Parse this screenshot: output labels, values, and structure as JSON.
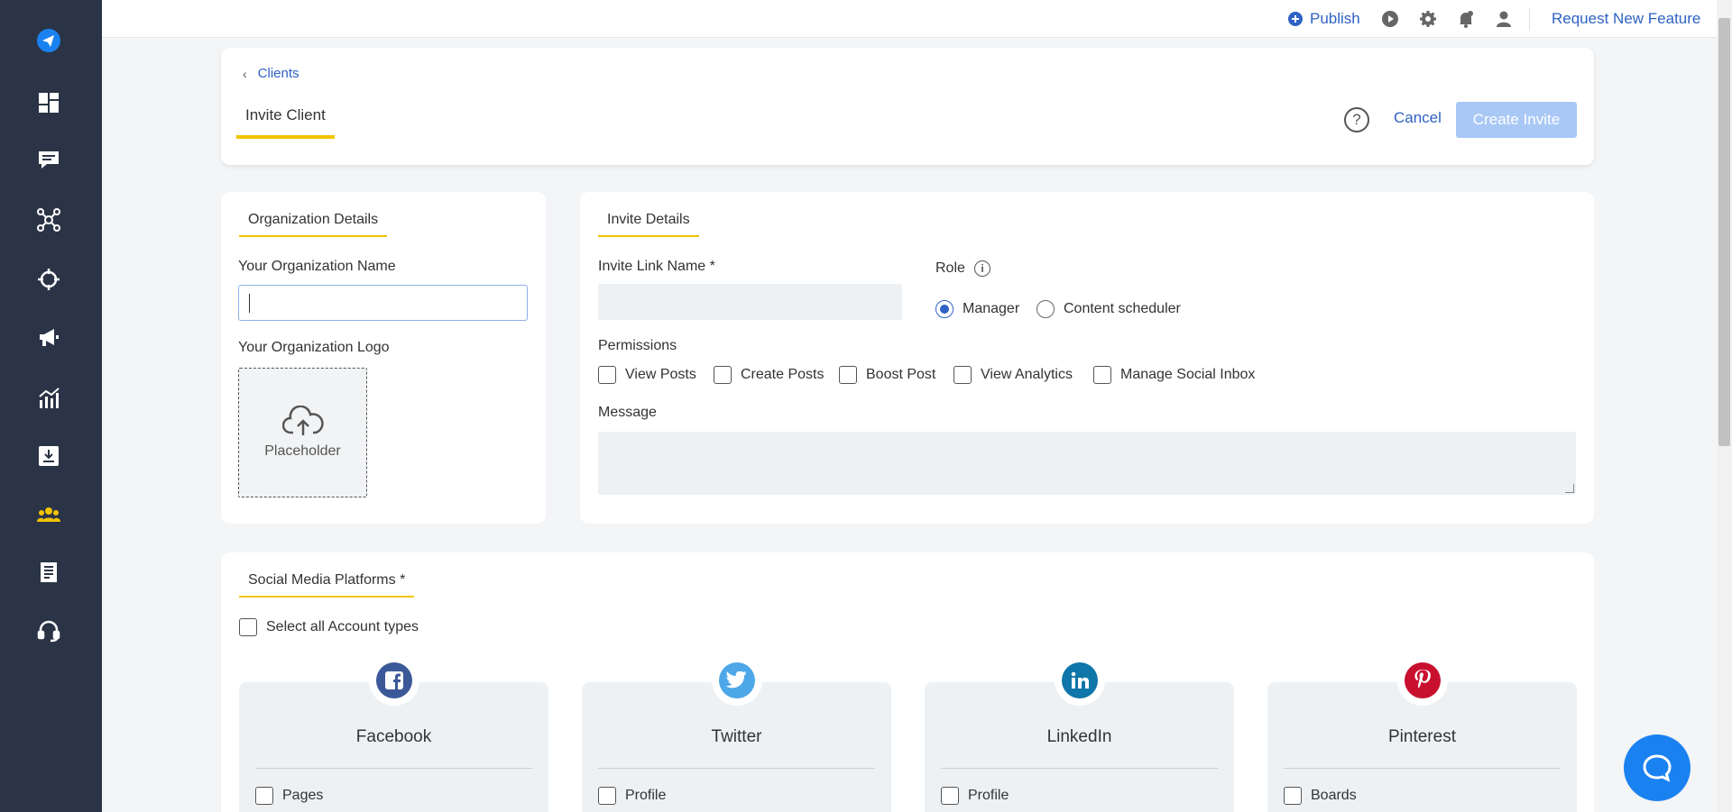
{
  "topbar": {
    "publish_label": "Publish",
    "request_feature_label": "Request New Feature"
  },
  "header": {
    "breadcrumb_label": "Clients",
    "tab_label": "Invite Client",
    "help_label": "?",
    "cancel_label": "Cancel",
    "create_label": "Create Invite"
  },
  "org": {
    "section_title": "Organization Details",
    "name_label": "Your Organization Name",
    "name_value": "",
    "logo_label": "Your Organization Logo",
    "logo_placeholder": "Placeholder"
  },
  "invite": {
    "section_title": "Invite Details",
    "link_label": "Invite Link Name *",
    "link_value": "",
    "role_label": "Role",
    "roles": [
      {
        "label": "Manager",
        "selected": true
      },
      {
        "label": "Content scheduler",
        "selected": false
      }
    ],
    "permissions_label": "Permissions",
    "permissions": [
      "View Posts",
      "Create Posts",
      "Boost Post",
      "View Analytics",
      "Manage Social Inbox"
    ],
    "message_label": "Message",
    "message_value": ""
  },
  "social": {
    "section_title": "Social Media Platforms *",
    "select_all_label": "Select all Account types",
    "platforms": [
      {
        "name": "Facebook",
        "option": "Pages",
        "color": "#3b5998"
      },
      {
        "name": "Twitter",
        "option": "Profile",
        "color": "#4da7e8"
      },
      {
        "name": "LinkedIn",
        "option": "Profile",
        "color": "#0e76a8"
      },
      {
        "name": "Pinterest",
        "option": "Boards",
        "color": "#c8102e"
      }
    ]
  },
  "colors": {
    "sidebar": "#2b3446",
    "accent": "#2f62c4",
    "underline": "#f3c400",
    "create_button": "#a9c8f6",
    "chat": "#1a82f0"
  }
}
